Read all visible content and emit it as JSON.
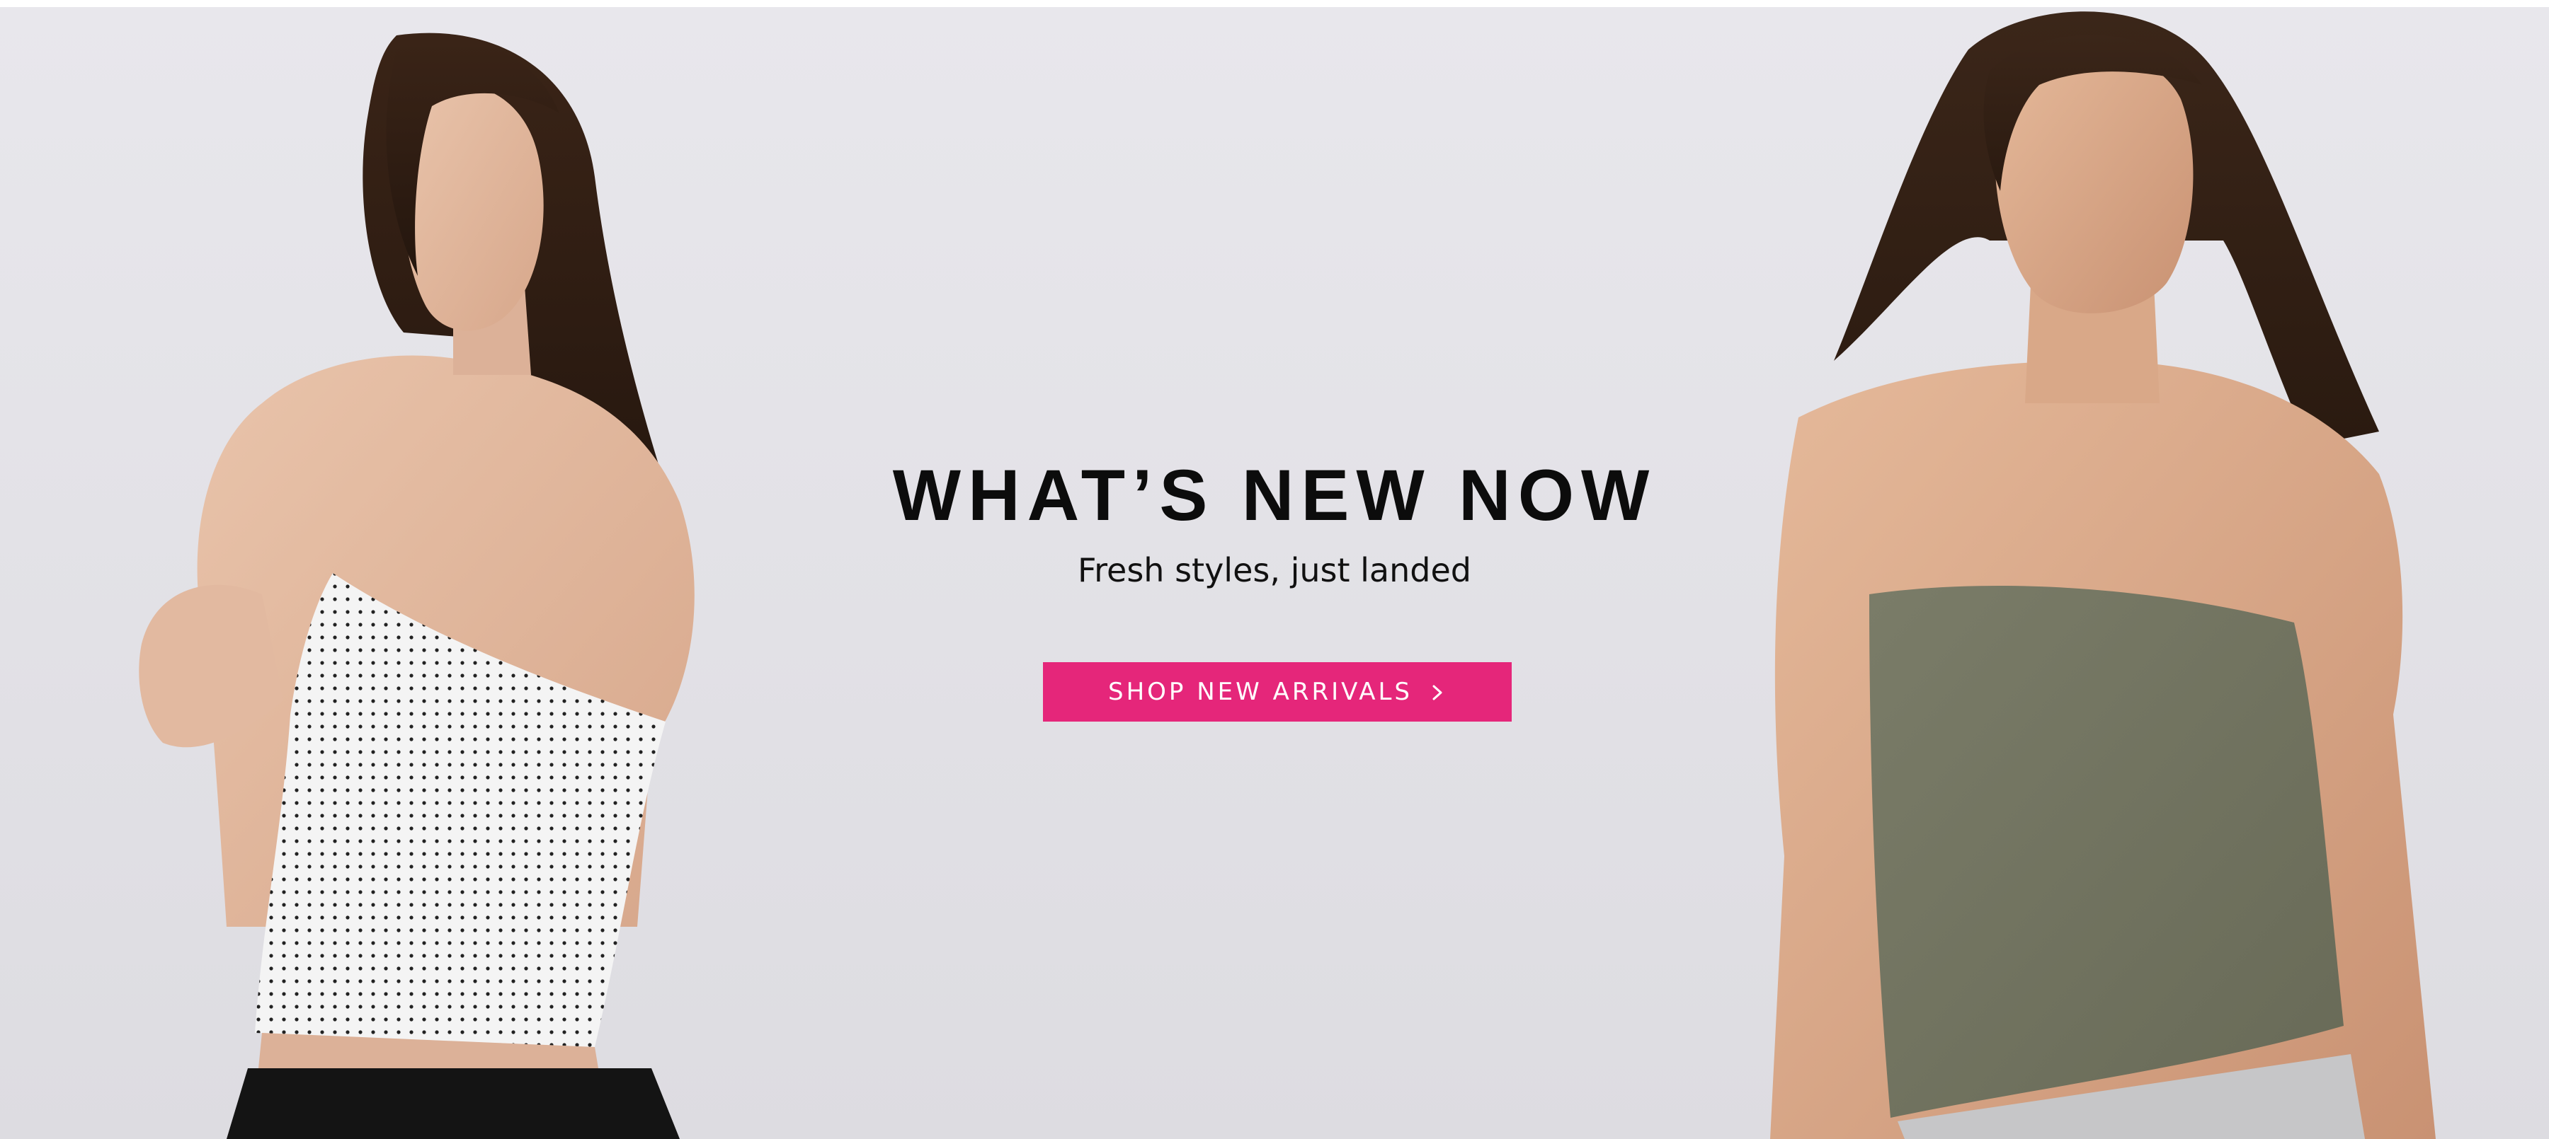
{
  "hero": {
    "title": "WHAT’S NEW NOW",
    "subtitle": "Fresh styles, just landed",
    "cta_label": "SHOP NEW ARRIVALS",
    "cta_icon": "chevron-right-icon",
    "colors": {
      "background": "#e4e3e8",
      "cta_background": "#e5267a",
      "cta_text": "#ffffff",
      "title_text": "#0c0c0c"
    }
  },
  "images": {
    "left": "model-in-white-polka-dot-strapless-top",
    "right": "model-in-olive-strapless-tube-top"
  }
}
